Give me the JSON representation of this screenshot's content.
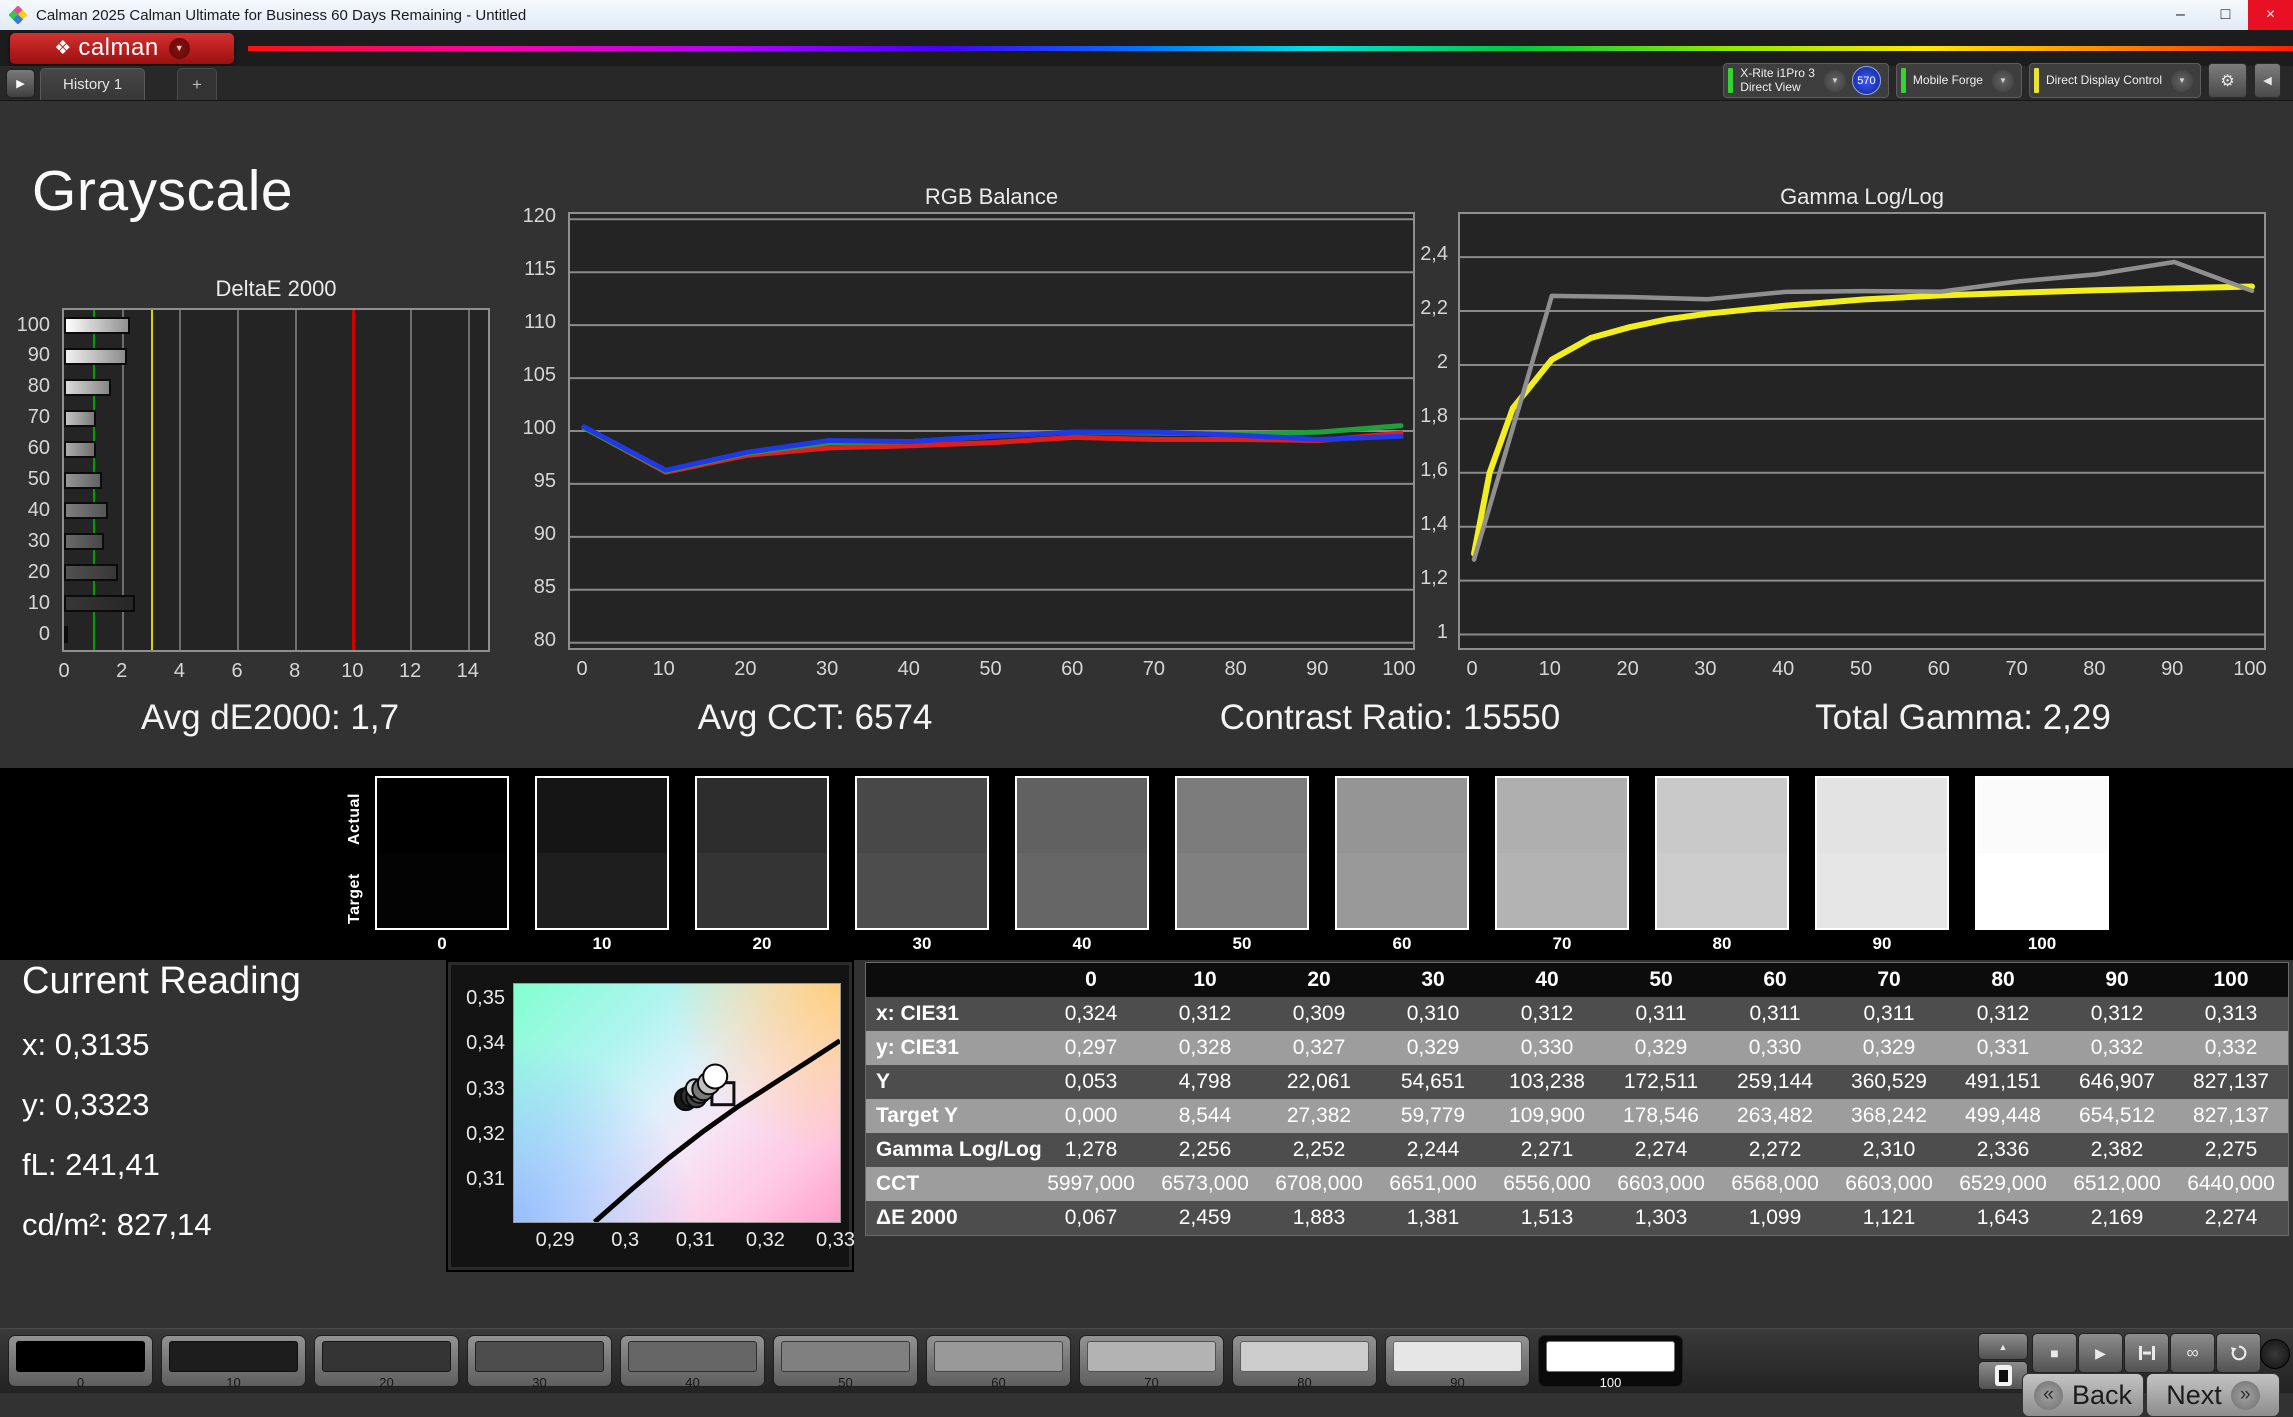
{
  "window": {
    "title": "Calman 2025 Calman Ultimate for Business 60 Days Remaining  - Untitled",
    "minimize_glyph": "–",
    "maximize_glyph": "□",
    "close_glyph": "×"
  },
  "brand": {
    "logo_text": "calman"
  },
  "history": {
    "tab_label": "History 1",
    "add_label": "+"
  },
  "meters": {
    "probe_line1": "X-Rite i1Pro 3",
    "probe_line2": "Direct View",
    "badge": "570",
    "pattern_source": "Mobile Forge",
    "display_control": "Direct Display Control"
  },
  "icons": {
    "play": "▶",
    "caret": "▼",
    "gear": "⚙",
    "collapse": "◀",
    "up": "▲",
    "stop": "■",
    "infinity": "∞",
    "back_chevron": "«",
    "next_chevron": "»"
  },
  "page": {
    "title": "Grayscale"
  },
  "summary": [
    "Avg dE2000: 1,7",
    "Avg CCT: 6574",
    "Contrast Ratio: 15550",
    "Total Gamma: 2,29"
  ],
  "chart_data": [
    {
      "type": "bar",
      "title": "DeltaE 2000",
      "orientation": "horizontal",
      "categories": [
        100,
        90,
        80,
        70,
        60,
        50,
        40,
        30,
        20,
        10,
        0
      ],
      "values": [
        2.274,
        2.169,
        1.643,
        1.121,
        1.099,
        1.303,
        1.513,
        1.381,
        1.883,
        2.459,
        0.067
      ],
      "xlim": [
        0,
        14.7
      ],
      "x_ticks": [
        0,
        2,
        4,
        6,
        8,
        10,
        12,
        14
      ],
      "reference_lines": [
        {
          "name": "good",
          "value": 1,
          "color": "#00a000"
        },
        {
          "name": "warning",
          "value": 3,
          "color": "#d8d400"
        },
        {
          "name": "bad",
          "value": 10,
          "color": "#cf0000"
        }
      ],
      "bar_gradients": [
        [
          "#ffffff",
          "#909090"
        ],
        [
          "#f1f1f1",
          "#8c8c8c"
        ],
        [
          "#dbdbdb",
          "#858585"
        ],
        [
          "#c3c3c3",
          "#7a7a7a"
        ],
        [
          "#ababab",
          "#6f6f6f"
        ],
        [
          "#959595",
          "#626262"
        ],
        [
          "#7f7f7f",
          "#545454"
        ],
        [
          "#696969",
          "#474747"
        ],
        [
          "#515151",
          "#373737"
        ],
        [
          "#373737",
          "#262626"
        ],
        [
          "#161616",
          "#0a0a0a"
        ]
      ],
      "footer": "Avg dE2000: 1,7"
    },
    {
      "type": "line",
      "title": "RGB Balance",
      "x": [
        0,
        10,
        20,
        30,
        40,
        50,
        60,
        70,
        80,
        90,
        100
      ],
      "ylim": [
        79.5,
        120.5
      ],
      "y_ticks": [
        120,
        115,
        110,
        105,
        100,
        95,
        90,
        85,
        80
      ],
      "series": [
        {
          "name": "Red",
          "color": "#e51c1c",
          "width": 5,
          "values": [
            100.3,
            96.1,
            97.7,
            98.4,
            98.6,
            98.9,
            99.4,
            99.2,
            99.2,
            99.1,
            99.8
          ]
        },
        {
          "name": "Green",
          "color": "#1fa03a",
          "width": 5,
          "values": [
            100.3,
            96.2,
            97.9,
            98.9,
            99.0,
            99.5,
            99.9,
            99.8,
            99.7,
            99.9,
            100.5
          ]
        },
        {
          "name": "Blue",
          "color": "#2138e8",
          "width": 5,
          "values": [
            100.4,
            96.3,
            98.0,
            99.1,
            99.0,
            99.5,
            99.9,
            99.9,
            99.6,
            99.2,
            99.5
          ]
        }
      ],
      "footer": "Avg CCT: 6574"
    },
    {
      "type": "line",
      "title": "Gamma Log/Log",
      "x": [
        0,
        10,
        20,
        30,
        40,
        50,
        60,
        70,
        80,
        90,
        100
      ],
      "ylim": [
        0.95,
        2.56
      ],
      "y_ticks": [
        {
          "value": 2.4,
          "label": "2,4"
        },
        {
          "value": 2.2,
          "label": "2,2"
        },
        {
          "value": 2.0,
          "label": "2"
        },
        {
          "value": 1.8,
          "label": "1,8"
        },
        {
          "value": 1.6,
          "label": "1,6"
        },
        {
          "value": 1.4,
          "label": "1,4"
        },
        {
          "value": 1.2,
          "label": "1,2"
        },
        {
          "value": 1.0,
          "label": "1"
        }
      ],
      "series": [
        {
          "name": "Target",
          "color": "#f2ee1f",
          "width": 6,
          "x": [
            0,
            2,
            5,
            10,
            15,
            20,
            25,
            30,
            40,
            50,
            60,
            70,
            80,
            90,
            100
          ],
          "values": [
            1.3,
            1.6,
            1.84,
            2.02,
            2.1,
            2.14,
            2.17,
            2.19,
            2.22,
            2.243,
            2.258,
            2.268,
            2.277,
            2.284,
            2.291
          ]
        },
        {
          "name": "Measured",
          "color": "#8f8f8f",
          "width": 4.5,
          "values": [
            1.278,
            2.256,
            2.252,
            2.244,
            2.271,
            2.274,
            2.272,
            2.31,
            2.336,
            2.382,
            2.275
          ]
        }
      ],
      "footer": "Total Gamma: 2,29"
    },
    {
      "type": "scatter",
      "title": "CIE xy detail",
      "xlim": [
        0.284,
        0.3305
      ],
      "ylim": [
        0.301,
        0.3535
      ],
      "x_ticks": [
        {
          "value": 0.29,
          "label": "0,29"
        },
        {
          "value": 0.3,
          "label": "0,3"
        },
        {
          "value": 0.31,
          "label": "0,31"
        },
        {
          "value": 0.32,
          "label": "0,32"
        },
        {
          "value": 0.33,
          "label": "0,33"
        }
      ],
      "y_ticks": [
        {
          "value": 0.35,
          "label": "0,35"
        },
        {
          "value": 0.34,
          "label": "0,34"
        },
        {
          "value": 0.33,
          "label": "0,33"
        },
        {
          "value": 0.32,
          "label": "0,32"
        },
        {
          "value": 0.31,
          "label": "0,31"
        }
      ],
      "locus": [
        [
          0.2955,
          0.301
        ],
        [
          0.301,
          0.3085
        ],
        [
          0.306,
          0.315
        ],
        [
          0.311,
          0.321
        ],
        [
          0.316,
          0.3265
        ],
        [
          0.321,
          0.3315
        ],
        [
          0.326,
          0.3365
        ],
        [
          0.3305,
          0.341
        ]
      ],
      "points": [
        {
          "x": 0.3085,
          "y": 0.3281,
          "color": "#181818",
          "r": 11
        },
        {
          "x": 0.3094,
          "y": 0.3288,
          "color": "#303030",
          "r": 11
        },
        {
          "x": 0.31,
          "y": 0.3285,
          "color": "#454545",
          "r": 10
        },
        {
          "x": 0.3105,
          "y": 0.3297,
          "color": "#606060",
          "r": 11
        },
        {
          "x": 0.3098,
          "y": 0.3305,
          "color": "#d8d8d8",
          "r": 9
        },
        {
          "x": 0.311,
          "y": 0.3303,
          "color": "#7a7a7a",
          "r": 11
        },
        {
          "x": 0.3118,
          "y": 0.3316,
          "color": "#c0c0c0",
          "r": 11
        },
        {
          "x": 0.3127,
          "y": 0.3331,
          "color": "#ffffff",
          "r": 12
        }
      ],
      "target_marker": {
        "x": 0.3138,
        "y": 0.3293
      }
    }
  ],
  "swatch_strip": {
    "row_labels": [
      "Actual",
      "Target"
    ],
    "levels": [
      "0",
      "10",
      "20",
      "30",
      "40",
      "50",
      "60",
      "70",
      "80",
      "90",
      "100"
    ],
    "actual_colors": [
      "#000000",
      "#151515",
      "#2d2d2d",
      "#484848",
      "#616161",
      "#7b7b7b",
      "#959595",
      "#afafaf",
      "#c9c9c9",
      "#e3e3e3",
      "#fbfbfb"
    ],
    "target_colors": [
      "#030303",
      "#1e1e1e",
      "#343434",
      "#4d4d4d",
      "#666666",
      "#808080",
      "#999999",
      "#b3b3b3",
      "#cccccc",
      "#e6e6e6",
      "#ffffff"
    ]
  },
  "current_reading": {
    "title": "Current Reading",
    "lines": [
      "x: 0,3135",
      "y: 0,3323",
      "fL: 241,41",
      "cd/m²: 827,14"
    ]
  },
  "table": {
    "columns": [
      "",
      "0",
      "10",
      "20",
      "30",
      "40",
      "50",
      "60",
      "70",
      "80",
      "90",
      "100"
    ],
    "rows": [
      {
        "label": "x: CIE31",
        "values": [
          "0,324",
          "0,312",
          "0,309",
          "0,310",
          "0,312",
          "0,311",
          "0,311",
          "0,311",
          "0,312",
          "0,312",
          "0,313"
        ]
      },
      {
        "label": "y: CIE31",
        "values": [
          "0,297",
          "0,328",
          "0,327",
          "0,329",
          "0,330",
          "0,329",
          "0,330",
          "0,329",
          "0,331",
          "0,332",
          "0,332"
        ]
      },
      {
        "label": "Y",
        "values": [
          "0,053",
          "4,798",
          "22,061",
          "54,651",
          "103,238",
          "172,511",
          "259,144",
          "360,529",
          "491,151",
          "646,907",
          "827,137"
        ]
      },
      {
        "label": "Target Y",
        "values": [
          "0,000",
          "8,544",
          "27,382",
          "59,779",
          "109,900",
          "178,546",
          "263,482",
          "368,242",
          "499,448",
          "654,512",
          "827,137"
        ]
      },
      {
        "label": "Gamma Log/Log",
        "values": [
          "1,278",
          "2,256",
          "2,252",
          "2,244",
          "2,271",
          "2,274",
          "2,272",
          "2,310",
          "2,336",
          "2,382",
          "2,275"
        ]
      },
      {
        "label": "CCT",
        "values": [
          "5997,000",
          "6573,000",
          "6708,000",
          "6651,000",
          "6556,000",
          "6603,000",
          "6568,000",
          "6603,000",
          "6529,000",
          "6512,000",
          "6440,000"
        ]
      },
      {
        "label": "ΔE 2000",
        "values": [
          "0,067",
          "2,459",
          "1,883",
          "1,381",
          "1,513",
          "1,303",
          "1,099",
          "1,121",
          "1,643",
          "2,169",
          "2,274"
        ]
      }
    ]
  },
  "toolbar": {
    "patches": [
      {
        "label": "0",
        "color": "#000000"
      },
      {
        "label": "10",
        "color": "#1d1d1d"
      },
      {
        "label": "20",
        "color": "#343434"
      },
      {
        "label": "30",
        "color": "#4d4d4d"
      },
      {
        "label": "40",
        "color": "#666666"
      },
      {
        "label": "50",
        "color": "#808080"
      },
      {
        "label": "60",
        "color": "#999999"
      },
      {
        "label": "70",
        "color": "#b3b3b3"
      },
      {
        "label": "80",
        "color": "#cccccc"
      },
      {
        "label": "90",
        "color": "#e6e6e6"
      },
      {
        "label": "100",
        "color": "#ffffff"
      }
    ],
    "selected": "100",
    "back_label": "Back",
    "next_label": "Next"
  },
  "colors": {
    "brand_red": "#c32222",
    "ref_green": "#00a000",
    "ref_yellow": "#d8d400",
    "ref_red": "#cf0000",
    "badge_blue": "#1e3fd0",
    "probe_accent": "#35d435",
    "source_accent": "#35d435",
    "control_accent": "#e8e23a"
  }
}
